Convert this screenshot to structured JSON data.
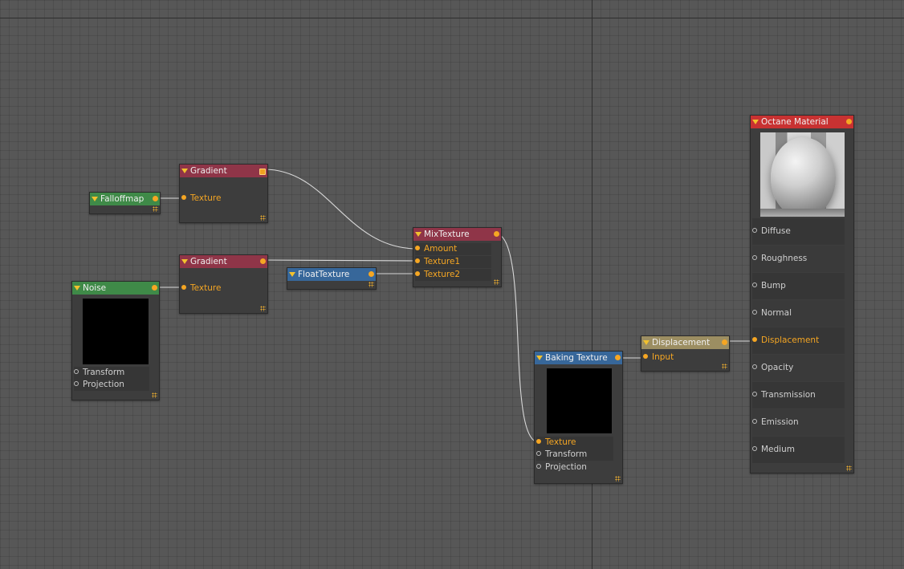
{
  "colors": {
    "gradient_header": "#8f3548",
    "green_header": "#3f8a48",
    "blue_header": "#37679a",
    "displacement_header": "#9c8e62",
    "material_header": "#c83232",
    "active_port": "#f5a623"
  },
  "nodes": {
    "gradient1": {
      "title": "Gradient",
      "inputs": [
        "Texture"
      ]
    },
    "falloffmap": {
      "title": "Falloffmap"
    },
    "gradient2": {
      "title": "Gradient",
      "inputs": [
        "Texture"
      ]
    },
    "noise": {
      "title": "Noise",
      "inputs": [
        "Transform",
        "Projection"
      ]
    },
    "floattexture": {
      "title": "FloatTexture"
    },
    "mixtexture": {
      "title": "MixTexture",
      "inputs": [
        "Amount",
        "Texture1",
        "Texture2"
      ]
    },
    "baking": {
      "title": "Baking Texture",
      "inputs": [
        "Texture",
        "Transform",
        "Projection"
      ]
    },
    "displacement": {
      "title": "Displacement",
      "inputs": [
        "Input"
      ]
    },
    "material": {
      "title": "Octane Material",
      "inputs": [
        "Diffuse",
        "Roughness",
        "Bump",
        "Normal",
        "Displacement",
        "Opacity",
        "Transmission",
        "Emission",
        "Medium"
      ]
    }
  }
}
